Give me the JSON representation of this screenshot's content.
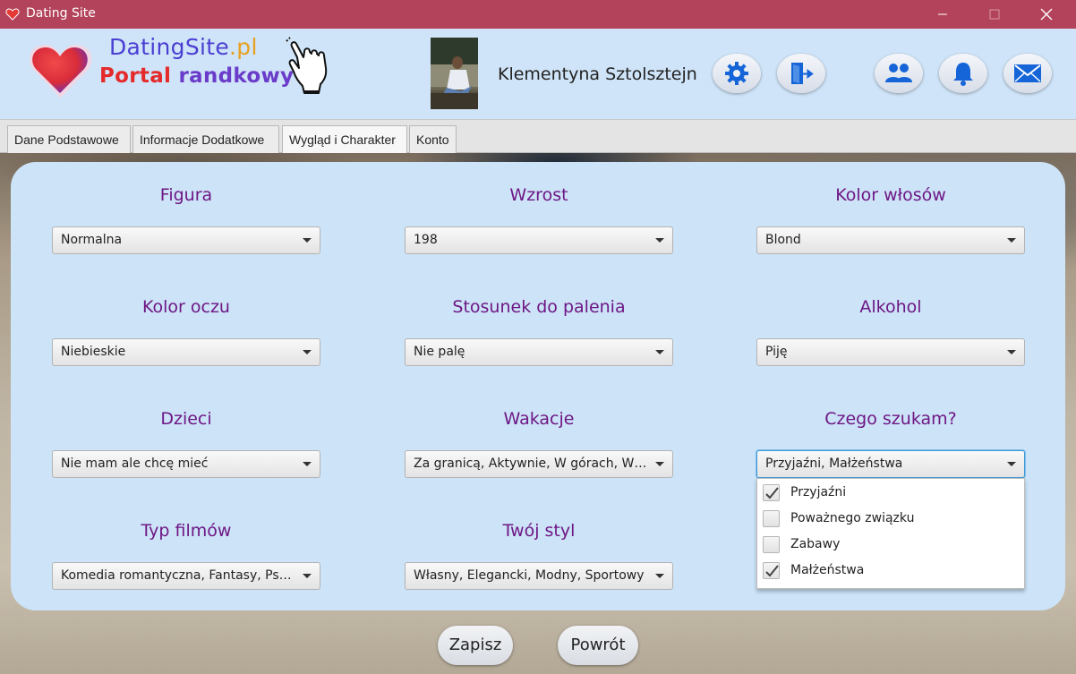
{
  "window": {
    "title": "Dating Site"
  },
  "header": {
    "logo_title": "DatingSite",
    "logo_tld": ".pl",
    "logo_subtitle_part1": "Portal ",
    "logo_subtitle_part2": "randkowy",
    "user_name": "Klementyna Sztolsztejn",
    "icons": [
      "heart-logo-icon",
      "pointing-hand-icon",
      "gear-icon",
      "logout-icon",
      "friends-icon",
      "bell-icon",
      "mail-icon"
    ]
  },
  "tabs": [
    {
      "label": "Dane Podstawowe",
      "active": false
    },
    {
      "label": "Informacje Dodatkowe",
      "active": false
    },
    {
      "label": "Wygląd i Charakter",
      "active": true
    },
    {
      "label": "Konto",
      "active": false
    }
  ],
  "fields": [
    {
      "label": "Figura",
      "value": "Normalna"
    },
    {
      "label": "Wzrost",
      "value": "198"
    },
    {
      "label": "Kolor włosów",
      "value": "Blond"
    },
    {
      "label": "Kolor oczu",
      "value": "Niebieskie"
    },
    {
      "label": "Stosunek do palenia",
      "value": "Nie palę"
    },
    {
      "label": "Alkohol",
      "value": "Piję"
    },
    {
      "label": "Dzieci",
      "value": "Nie mam ale chcę mieć"
    },
    {
      "label": "Wakacje",
      "value": "Za granicą, Aktywnie, W górach, W ..."
    },
    {
      "label": "Czego szukam?",
      "value": "Przyjaźni, Małżeństwa"
    },
    {
      "label": "Typ filmów",
      "value": "Komedia romantyczna, Fantasy, Psy..."
    },
    {
      "label": "Twój styl",
      "value": "Własny, Elegancki, Modny, Sportowy"
    }
  ],
  "dropdown": {
    "items": [
      {
        "label": "Przyjaźni",
        "checked": true
      },
      {
        "label": "Poważnego związku",
        "checked": false
      },
      {
        "label": "Zabawy",
        "checked": false
      },
      {
        "label": "Małżeństwa",
        "checked": true
      }
    ]
  },
  "actions": {
    "save_label": "Zapisz",
    "back_label": "Powrót"
  },
  "colors": {
    "titlebar": "#b3435a",
    "panel": "#cce3f8",
    "label": "#6e1784",
    "icon_blue": "#1565d8"
  }
}
